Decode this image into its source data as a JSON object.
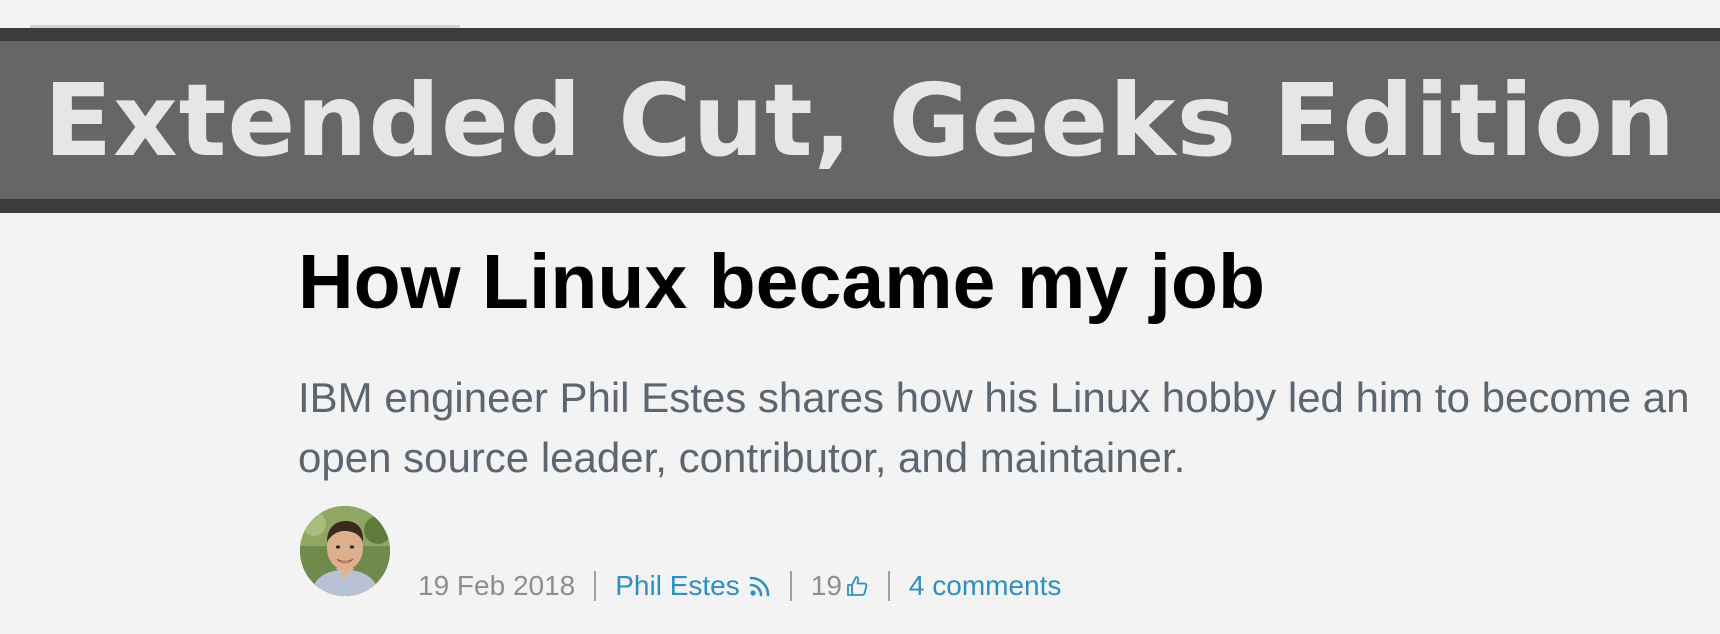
{
  "banner": {
    "title": "Extended Cut, Geeks Edition"
  },
  "article": {
    "title": "How Linux became my job",
    "summary": "IBM engineer Phil Estes shares how his Linux hobby led him to become an open source leader, contributor, and maintainer.",
    "meta": {
      "date": "19 Feb 2018",
      "author": "Phil Estes",
      "likes": "19",
      "comments": "4 comments"
    }
  },
  "icons": {
    "author_feed": "rss-icon",
    "likes": "thumbs-up-icon",
    "avatar": "author-avatar"
  },
  "colors": {
    "banner_dark": "#3c3c3c",
    "banner": "#666666",
    "banner_text": "#e6e6e6",
    "link": "#2f8fc0",
    "summary_text": "#5c6670",
    "meta_text": "#8a8f94"
  }
}
